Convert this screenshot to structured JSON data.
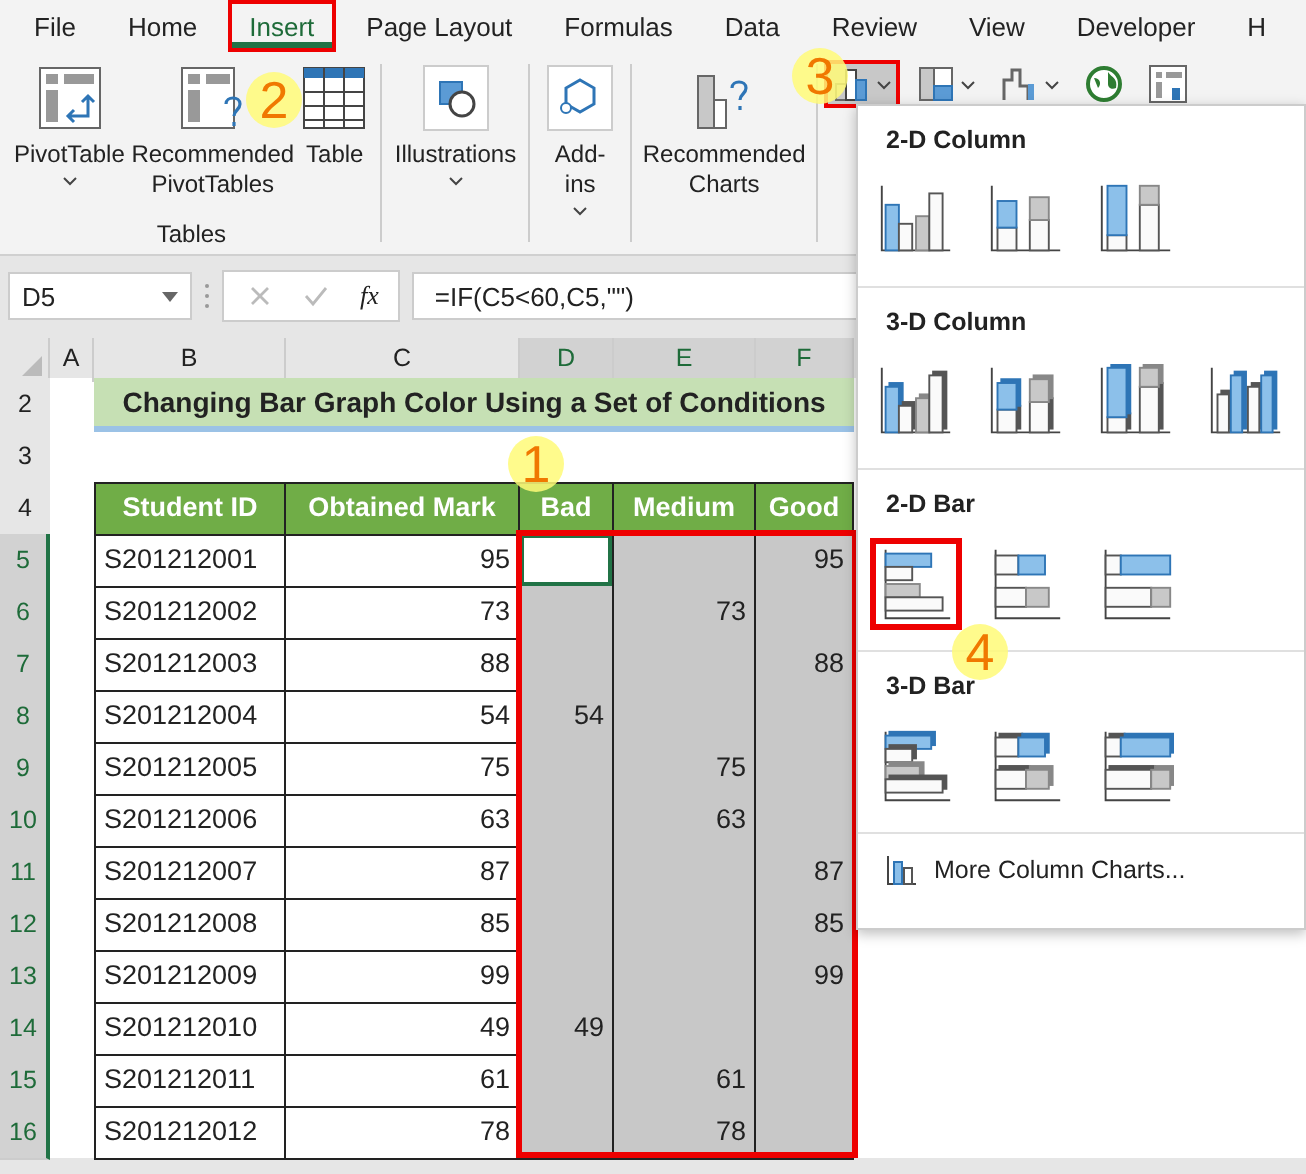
{
  "ribbon_tabs": [
    {
      "label": "File",
      "selected": false,
      "highlighted": false
    },
    {
      "label": "Home",
      "selected": false,
      "highlighted": false
    },
    {
      "label": "Insert",
      "selected": true,
      "highlighted": true
    },
    {
      "label": "Page Layout",
      "selected": false,
      "highlighted": false
    },
    {
      "label": "Formulas",
      "selected": false,
      "highlighted": false
    },
    {
      "label": "Data",
      "selected": false,
      "highlighted": false
    },
    {
      "label": "Review",
      "selected": false,
      "highlighted": false
    },
    {
      "label": "View",
      "selected": false,
      "highlighted": false
    },
    {
      "label": "Developer",
      "selected": false,
      "highlighted": false
    },
    {
      "label": "H",
      "selected": false,
      "highlighted": false
    }
  ],
  "ribbon_groups": [
    {
      "label": "Tables",
      "buttons": [
        {
          "label": "PivotTable",
          "dropdown": true
        },
        {
          "label": "Recommended PivotTables",
          "dropdown": false
        },
        {
          "label": "Table",
          "dropdown": false
        }
      ]
    },
    {
      "buttons": [
        {
          "label": "Illustrations",
          "dropdown": true
        }
      ]
    },
    {
      "buttons": [
        {
          "label": "Add-ins",
          "dropdown": true
        }
      ]
    },
    {
      "buttons": [
        {
          "label": "Recommended Charts",
          "dropdown": false
        }
      ]
    }
  ],
  "chart_buttons": [
    {
      "dropdown": true,
      "highlighted": true
    },
    {
      "dropdown": true,
      "highlighted": false
    },
    {
      "dropdown": true,
      "highlighted": false
    },
    {
      "dropdown": false,
      "highlighted": false
    },
    {
      "dropdown": false,
      "highlighted": false
    }
  ],
  "formula_bar": {
    "name_box": "D5",
    "fx": "fx",
    "formula": "=IF(C5<60,C5,\"\")"
  },
  "sheet": {
    "columns": [
      {
        "label": "A",
        "selected": false
      },
      {
        "label": "B",
        "selected": false
      },
      {
        "label": "C",
        "selected": false
      },
      {
        "label": "D",
        "selected": true
      },
      {
        "label": "E",
        "selected": true
      },
      {
        "label": "F",
        "selected": true
      }
    ],
    "title_row": "2",
    "blank_row": "3",
    "header_row": "4",
    "title": "Changing Bar Graph Color Using a Set of Conditions",
    "header_cells": [
      {},
      {
        "text": "Student ID"
      },
      {
        "text": "Obtained Mark"
      },
      {
        "text": "Bad"
      },
      {
        "text": "Medium"
      },
      {
        "text": "Good"
      }
    ],
    "selection_highlighted": true,
    "rows": [
      {
        "number": "5",
        "selected": true,
        "cells": [
          {},
          {
            "text": "S201212001"
          },
          {
            "text": "95"
          },
          {
            "active": true
          },
          {
            "selected": true
          },
          {
            "text": "95",
            "selected": true
          }
        ]
      },
      {
        "number": "6",
        "selected": true,
        "cells": [
          {},
          {
            "text": "S201212002"
          },
          {
            "text": "73"
          },
          {
            "selected": true
          },
          {
            "text": "73",
            "selected": true
          },
          {
            "selected": true
          }
        ]
      },
      {
        "number": "7",
        "selected": true,
        "cells": [
          {},
          {
            "text": "S201212003"
          },
          {
            "text": "88"
          },
          {
            "selected": true
          },
          {
            "selected": true
          },
          {
            "text": "88",
            "selected": true
          }
        ]
      },
      {
        "number": "8",
        "selected": true,
        "cells": [
          {},
          {
            "text": "S201212004"
          },
          {
            "text": "54"
          },
          {
            "text": "54",
            "selected": true
          },
          {
            "selected": true
          },
          {
            "selected": true
          }
        ]
      },
      {
        "number": "9",
        "selected": true,
        "cells": [
          {},
          {
            "text": "S201212005"
          },
          {
            "text": "75"
          },
          {
            "selected": true
          },
          {
            "text": "75",
            "selected": true
          },
          {
            "selected": true
          }
        ]
      },
      {
        "number": "10",
        "selected": true,
        "cells": [
          {},
          {
            "text": "S201212006"
          },
          {
            "text": "63"
          },
          {
            "selected": true
          },
          {
            "text": "63",
            "selected": true
          },
          {
            "selected": true
          }
        ]
      },
      {
        "number": "11",
        "selected": true,
        "cells": [
          {},
          {
            "text": "S201212007"
          },
          {
            "text": "87"
          },
          {
            "selected": true
          },
          {
            "selected": true
          },
          {
            "text": "87",
            "selected": true
          }
        ]
      },
      {
        "number": "12",
        "selected": true,
        "cells": [
          {},
          {
            "text": "S201212008"
          },
          {
            "text": "85"
          },
          {
            "selected": true
          },
          {
            "selected": true
          },
          {
            "text": "85",
            "selected": true
          }
        ]
      },
      {
        "number": "13",
        "selected": true,
        "cells": [
          {},
          {
            "text": "S201212009"
          },
          {
            "text": "99"
          },
          {
            "selected": true
          },
          {
            "selected": true
          },
          {
            "text": "99",
            "selected": true
          }
        ]
      },
      {
        "number": "14",
        "selected": true,
        "cells": [
          {},
          {
            "text": "S201212010"
          },
          {
            "text": "49"
          },
          {
            "text": "49",
            "selected": true
          },
          {
            "selected": true
          },
          {
            "selected": true
          }
        ]
      },
      {
        "number": "15",
        "selected": true,
        "cells": [
          {},
          {
            "text": "S201212011"
          },
          {
            "text": "61"
          },
          {
            "selected": true
          },
          {
            "text": "61",
            "selected": true
          },
          {
            "selected": true
          }
        ]
      },
      {
        "number": "16",
        "selected": true,
        "cells": [
          {},
          {
            "text": "S201212012"
          },
          {
            "text": "78"
          },
          {
            "selected": true
          },
          {
            "text": "78",
            "selected": true
          },
          {
            "selected": true
          }
        ]
      }
    ]
  },
  "chart_menu": {
    "sections": [
      {
        "title": "2-D Column",
        "kind": "column2d",
        "items": [
          {
            "highlighted": false
          },
          {
            "highlighted": false
          },
          {
            "highlighted": false
          }
        ]
      },
      {
        "title": "3-D Column",
        "kind": "column3d",
        "items": [
          {
            "highlighted": false
          },
          {
            "highlighted": false
          },
          {
            "highlighted": false
          },
          {
            "highlighted": false
          }
        ]
      },
      {
        "title": "2-D Bar",
        "kind": "bar2d",
        "items": [
          {
            "highlighted": true
          },
          {
            "highlighted": false
          },
          {
            "highlighted": false
          }
        ]
      },
      {
        "title": "3-D Bar",
        "kind": "bar3d",
        "items": [
          {
            "highlighted": false
          },
          {
            "highlighted": false
          },
          {
            "highlighted": false
          }
        ]
      }
    ],
    "more": "More Column Charts..."
  },
  "steps": [
    "1",
    "2",
    "3",
    "4"
  ]
}
